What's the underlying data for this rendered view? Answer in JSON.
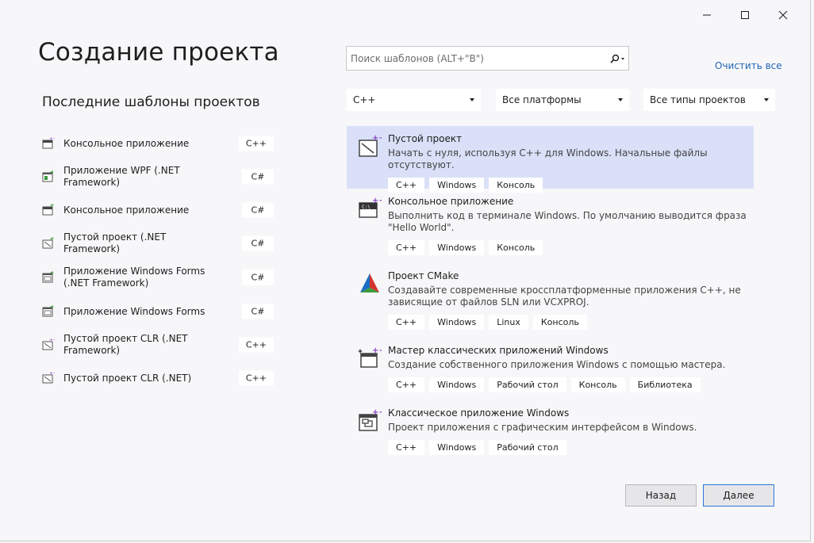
{
  "window": {
    "controls": [
      "minimize-icon",
      "maximize-icon",
      "close-icon"
    ]
  },
  "page": {
    "title": "Создание проекта"
  },
  "recent": {
    "title": "Последние шаблоны проектов",
    "items": [
      {
        "label": "Консольное приложение",
        "lang": "C++",
        "icon": "console-app-icon"
      },
      {
        "label": "Приложение WPF (.NET Framework)",
        "lang": "C#",
        "icon": "wpf-app-icon"
      },
      {
        "label": "Консольное приложение",
        "lang": "C#",
        "icon": "console-app-icon"
      },
      {
        "label": "Пустой проект (.NET Framework)",
        "lang": "C#",
        "icon": "empty-project-icon"
      },
      {
        "label": "Приложение Windows Forms (.NET Framework)",
        "lang": "C#",
        "icon": "winforms-app-icon"
      },
      {
        "label": "Приложение Windows Forms",
        "lang": "C#",
        "icon": "winforms-app-icon"
      },
      {
        "label": "Пустой проект CLR (.NET Framework)",
        "lang": "C++",
        "icon": "clr-empty-project-icon"
      },
      {
        "label": "Пустой проект CLR (.NET)",
        "lang": "C++",
        "icon": "clr-empty-project-icon"
      }
    ]
  },
  "search": {
    "placeholder": "Поиск шаблонов (ALT+\"В\")",
    "value": ""
  },
  "clear_all": "Очистить все",
  "filters": {
    "language": "C++",
    "platform": "Все платформы",
    "project_type": "Все типы проектов"
  },
  "templates": [
    {
      "name": "Пустой проект",
      "desc": "Начать с нуля, используя C++ для Windows. Начальные файлы отсутствуют.",
      "tags": [
        "C++",
        "Windows",
        "Консоль"
      ],
      "selected": true,
      "icon": "empty-project-icon"
    },
    {
      "name": "Консольное приложение",
      "desc": "Выполнить код в терминале Windows. По умолчанию выводится фраза \"Hello World\".",
      "tags": [
        "C++",
        "Windows",
        "Консоль"
      ],
      "selected": false,
      "icon": "console-app-icon"
    },
    {
      "name": "Проект CMake",
      "desc": "Создавайте современные кроссплатформенные приложения C++, не зависящие от файлов SLN или VCXPROJ.",
      "tags": [
        "C++",
        "Windows",
        "Linux",
        "Консоль"
      ],
      "selected": false,
      "icon": "cmake-icon"
    },
    {
      "name": "Мастер классических приложений Windows",
      "desc": "Создание собственного приложения Windows с помощью мастера.",
      "tags": [
        "C++",
        "Windows",
        "Рабочий стол",
        "Консоль",
        "Библиотека"
      ],
      "selected": false,
      "icon": "desktop-wizard-icon"
    },
    {
      "name": "Классическое приложение Windows",
      "desc": "Проект приложения с графическим интерфейсом в Windows.",
      "tags": [
        "C++",
        "Windows",
        "Рабочий стол"
      ],
      "selected": false,
      "icon": "desktop-app-icon"
    }
  ],
  "buttons": {
    "back": "Назад",
    "next": "Далее"
  },
  "colors": {
    "accent": "#2b78d6",
    "link": "#1f64b4",
    "selection": "#d9e0f8",
    "plus_badge": "#8a3fc6"
  }
}
